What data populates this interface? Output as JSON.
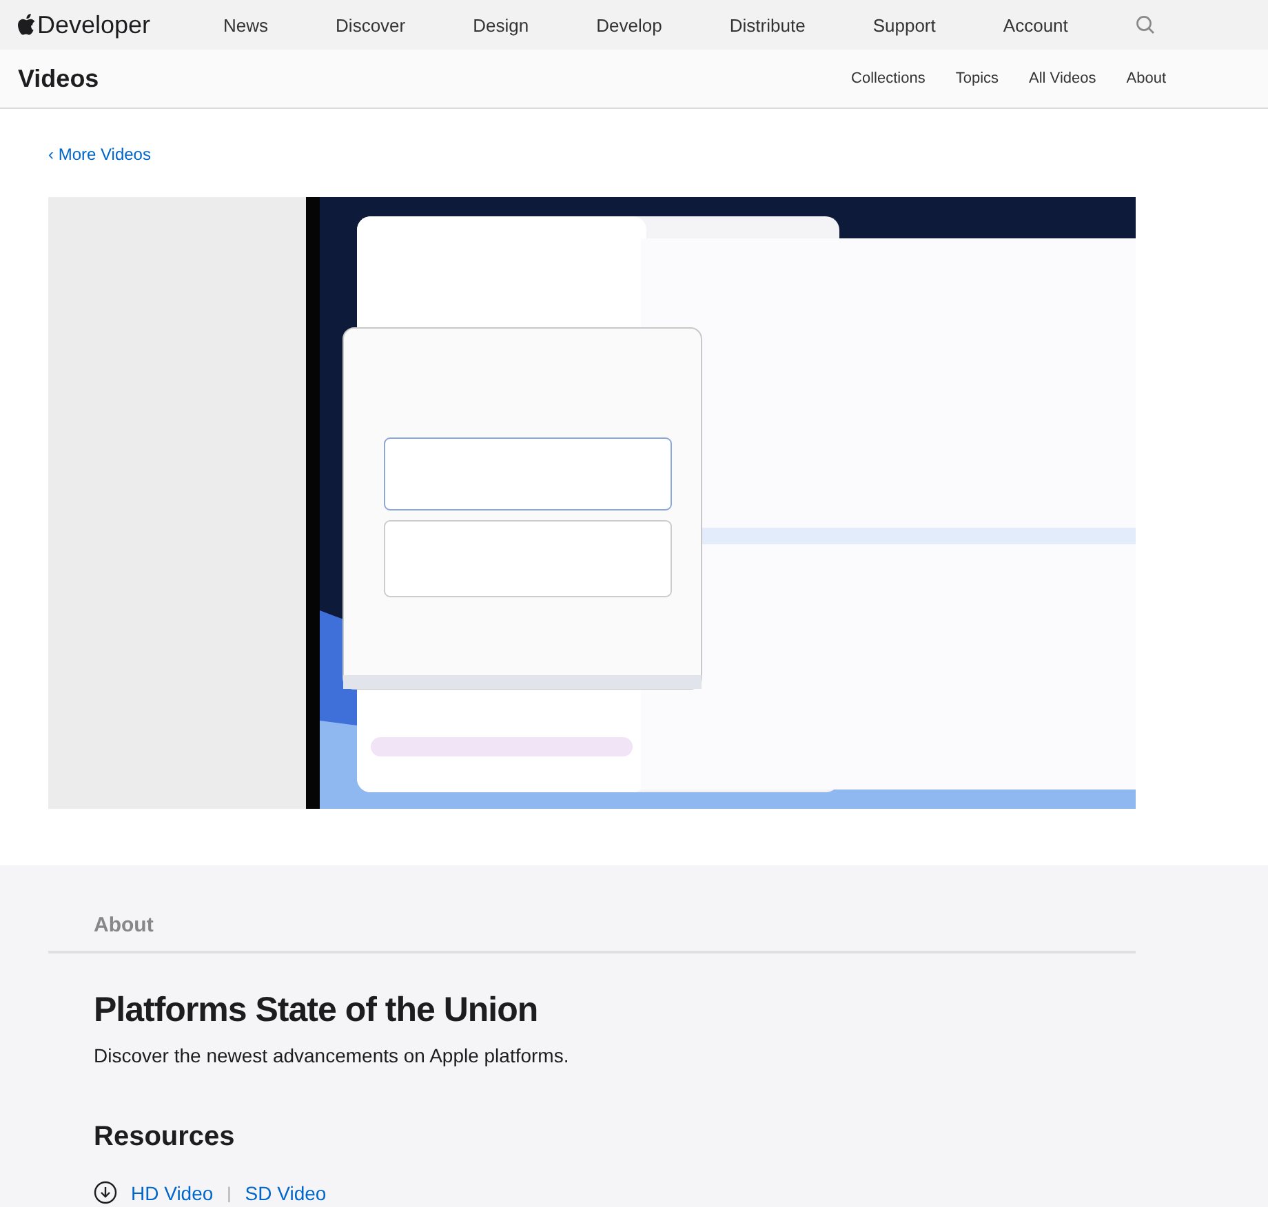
{
  "global_nav": {
    "brand": "Developer",
    "items": [
      "News",
      "Discover",
      "Design",
      "Develop",
      "Distribute",
      "Support",
      "Account"
    ]
  },
  "sub_nav": {
    "title": "Videos",
    "items": [
      "Collections",
      "Topics",
      "All Videos",
      "About"
    ]
  },
  "back_link": "‹ More Videos",
  "about": {
    "heading": "About",
    "title": "Platforms State of the Union",
    "description": "Discover the newest advancements on Apple platforms."
  },
  "resources": {
    "heading": "Resources",
    "links": [
      "HD Video",
      "SD Video"
    ],
    "separator": "|"
  }
}
